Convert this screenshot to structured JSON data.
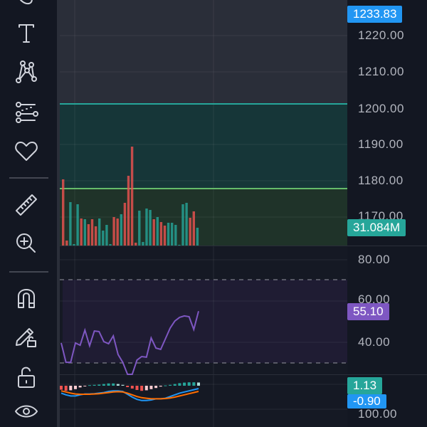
{
  "toolbar": {
    "tools": [
      "brush-tool",
      "text-tool",
      "pattern-tool",
      "fib-tool",
      "favorites",
      "ruler",
      "zoom-in",
      "magnet",
      "lock-drawings",
      "lock-all",
      "hide-drawings"
    ]
  },
  "price_axis": {
    "ticks": [
      "1220.00",
      "1210.00",
      "1200.00",
      "1190.00",
      "1180.00",
      "1170.00"
    ],
    "last_price": "1233.83",
    "volume_badge": "31.084M"
  },
  "rsi_axis": {
    "ticks": [
      "80.00",
      "60.00",
      "40.00"
    ],
    "value_badge": "55.10"
  },
  "macd_axis": {
    "histogram_badge": "1.13",
    "signal_badge": "-0.90",
    "next_pane_tick": "100.00"
  },
  "colors": {
    "up": "#26a69a",
    "down": "#ef5350",
    "rsi": "#7e57c2",
    "macd": "#2196f3",
    "signal": "#ff6d00",
    "zone_upper": "#163638",
    "zone_lower": "#1f3329"
  },
  "chart_data": [
    {
      "type": "bar",
      "title": "Volume",
      "values": [
        93,
        7,
        61,
        2,
        58,
        38,
        37,
        30,
        37,
        27,
        38,
        21,
        29,
        2,
        40,
        38,
        44,
        60,
        98,
        139,
        4,
        49,
        5,
        52,
        50,
        37,
        40,
        33,
        28,
        32,
        32,
        29,
        1,
        58,
        60,
        39,
        48,
        25
      ],
      "directions": [
        "d",
        "d",
        "u",
        "u",
        "u",
        "d",
        "u",
        "d",
        "d",
        "d",
        "u",
        "u",
        "u",
        "u",
        "d",
        "d",
        "u",
        "d",
        "d",
        "d",
        "d",
        "u",
        "u",
        "u",
        "u",
        "d",
        "u",
        "d",
        "d",
        "u",
        "u",
        "u",
        "u",
        "u",
        "u",
        "d",
        "d",
        "u"
      ]
    },
    {
      "type": "line",
      "title": "RSI",
      "ylim": [
        20,
        85
      ],
      "levels": [
        70,
        30
      ],
      "values": [
        39.7,
        30.3,
        30.3,
        39.7,
        38.6,
        45.9,
        38.3,
        45.5,
        45.2,
        40.3,
        39.3,
        43.1,
        34.1,
        30.3,
        24.5,
        24.5,
        31.4,
        33.1,
        32.8,
        42.1,
        37.2,
        36.6,
        41.7,
        46.9,
        50.3,
        52.1,
        52.8,
        52.4,
        46.2,
        55.1
      ]
    },
    {
      "type": "bar+line",
      "title": "MACD",
      "histogram": [
        -1.4,
        -1.8,
        -1.6,
        -1.2,
        -0.6,
        -0.2,
        0.2,
        0.3,
        0.4,
        0.6,
        0.8,
        0.8,
        0.6,
        0.3,
        -0.5,
        -1.0,
        -1.5,
        -1.8,
        -1.6,
        -1.2,
        -0.8,
        -0.3,
        0.1,
        0.3,
        0.6,
        0.9,
        1.1,
        1.2,
        1.2,
        1.13
      ],
      "macd": [
        -1.6,
        -2.2,
        -2.6,
        -2.6,
        -2.2,
        -1.9,
        -1.9,
        -1.8,
        -1.6,
        -1.4,
        -1.0,
        -0.8,
        -0.8,
        -1.0,
        -2.0,
        -3.0,
        -3.8,
        -4.2,
        -4.2,
        -4.0,
        -3.6,
        -3.6,
        -3.4,
        -2.8,
        -2.2,
        -1.6,
        -1.2,
        -0.8,
        -0.4,
        0.0
      ],
      "signal": [
        -0.8,
        -1.2,
        -1.6,
        -1.9,
        -2.0,
        -2.0,
        -2.0,
        -1.9,
        -1.8,
        -1.6,
        -1.4,
        -1.2,
        -1.1,
        -1.2,
        -1.6,
        -2.2,
        -2.8,
        -3.2,
        -3.4,
        -3.6,
        -3.6,
        -3.6,
        -3.5,
        -3.3,
        -3.0,
        -2.6,
        -2.2,
        -1.8,
        -1.4,
        -1.0
      ]
    }
  ]
}
